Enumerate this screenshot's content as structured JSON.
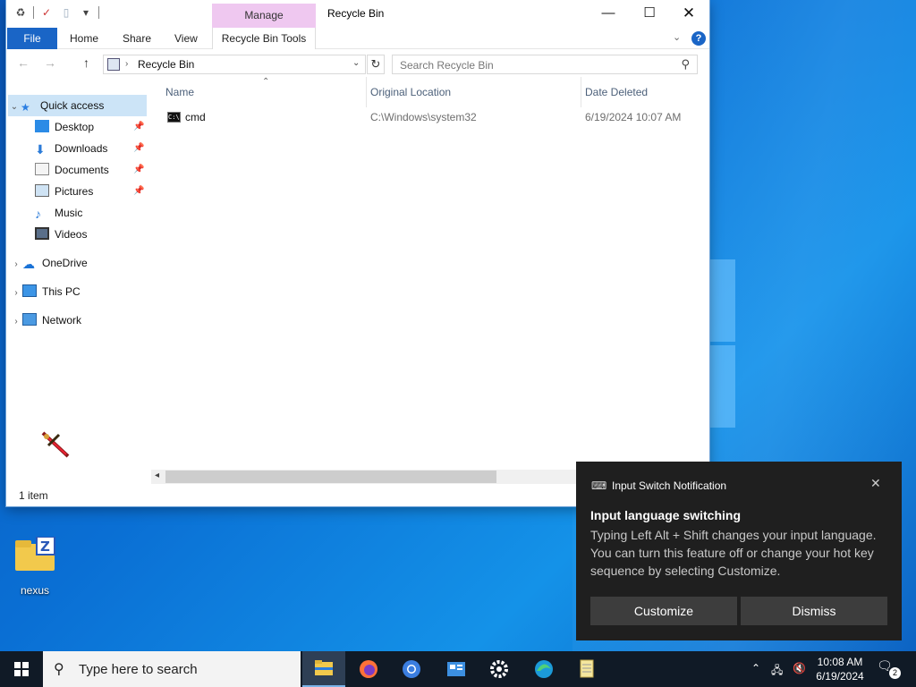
{
  "explorer": {
    "title": "Recycle Bin",
    "ribbon": {
      "context_group": "Manage",
      "tabs": [
        "File",
        "Home",
        "Share",
        "View",
        "Recycle Bin Tools"
      ]
    },
    "address": {
      "path": "Recycle Bin"
    },
    "search": {
      "placeholder": "Search Recycle Bin"
    },
    "nav_pane": {
      "quick_access": "Quick access",
      "items": [
        "Desktop",
        "Downloads",
        "Documents",
        "Pictures",
        "Music",
        "Videos"
      ],
      "onedrive": "OneDrive",
      "this_pc": "This PC",
      "network": "Network"
    },
    "columns": [
      "Name",
      "Original Location",
      "Date Deleted"
    ],
    "rows": [
      {
        "name": "cmd",
        "location": "C:\\Windows\\system32",
        "date": "6/19/2024 10:07 AM"
      }
    ],
    "status": "1 item"
  },
  "desktop": {
    "icons": [
      {
        "label": "nexus"
      }
    ]
  },
  "toast": {
    "app": "Input Switch Notification",
    "title": "Input language switching",
    "body": "Typing Left Alt + Shift changes your input language. You can turn this feature off or change your hot key sequence by selecting Customize.",
    "buttons": [
      "Customize",
      "Dismiss"
    ]
  },
  "taskbar": {
    "search_placeholder": "Type here to search",
    "time": "10:08 AM",
    "date": "6/19/2024",
    "notification_count": "2",
    "pinned": [
      "file-explorer",
      "firefox",
      "chrome",
      "control-panel",
      "settings",
      "edge",
      "notepad"
    ]
  },
  "colors": {
    "accent": "#1a65c6",
    "manage_tab": "#efc8f0",
    "selection": "#cce4f7",
    "taskbar": "#101a26",
    "toast_bg": "#1f1f1f"
  }
}
